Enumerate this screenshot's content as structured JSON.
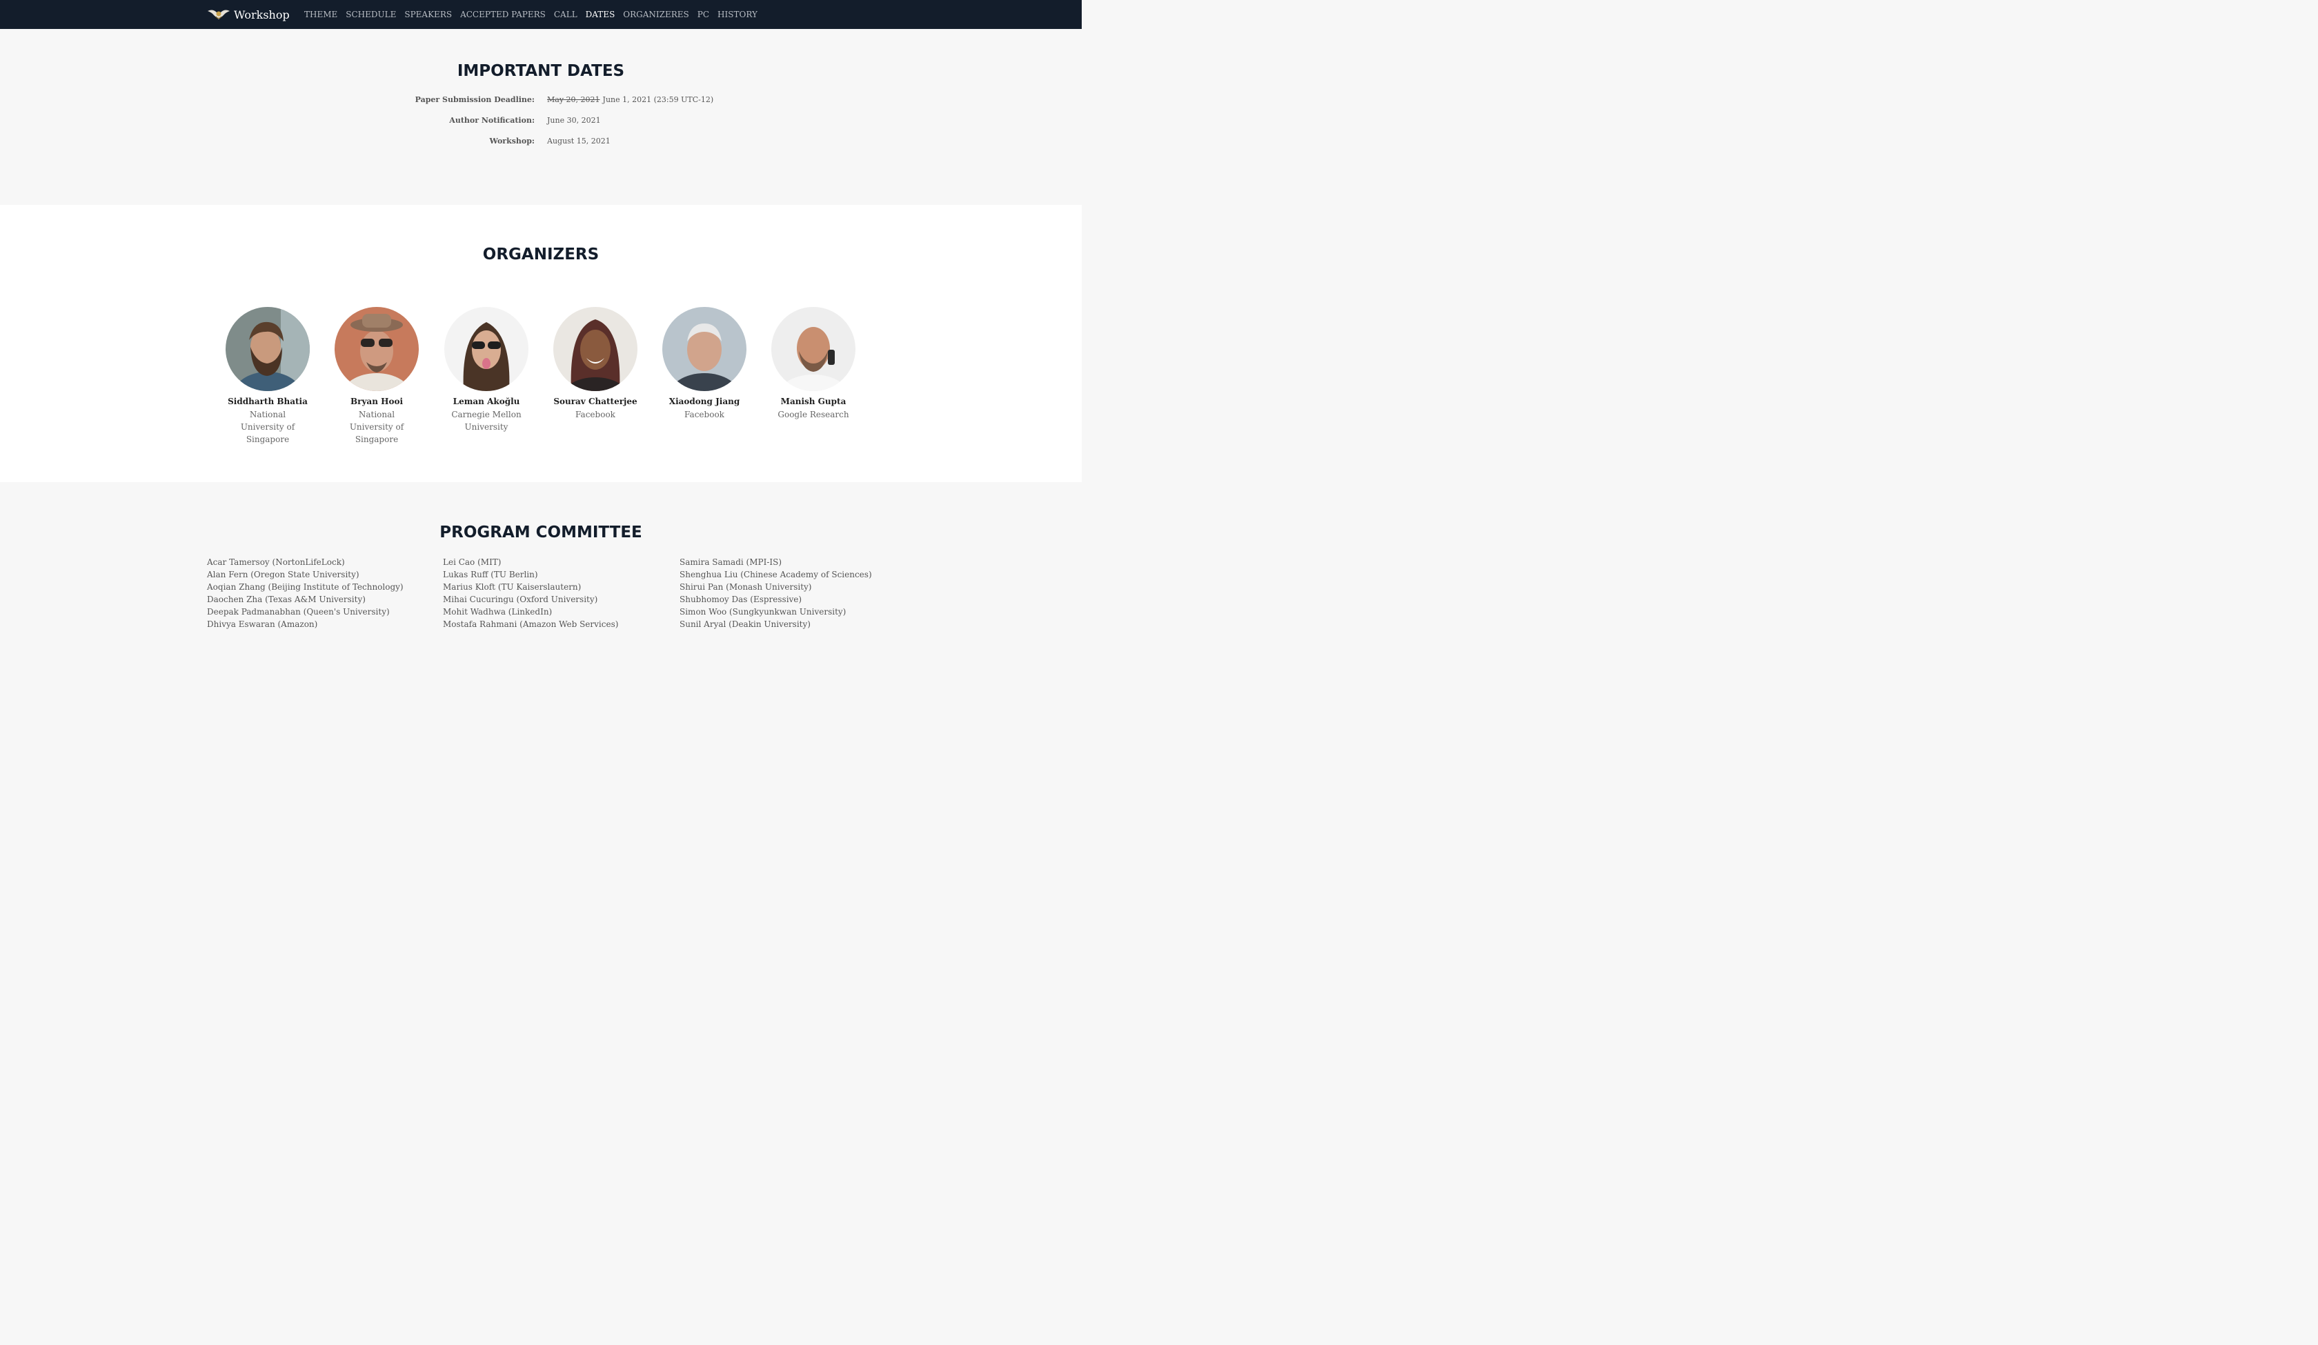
{
  "nav": {
    "brand": "Workshop",
    "links": [
      "THEME",
      "SCHEDULE",
      "SPEAKERS",
      "ACCEPTED PAPERS",
      "CALL",
      "DATES",
      "ORGANIZERES",
      "PC",
      "HISTORY"
    ],
    "active": "DATES"
  },
  "dates": {
    "title": "IMPORTANT DATES",
    "rows": [
      {
        "label": "Paper Submission Deadline:",
        "old_value": "May 20, 2021",
        "value": "June 1, 2021 (23:59 UTC-12)"
      },
      {
        "label": "Author Notification:",
        "value": "June 30, 2021"
      },
      {
        "label": "Workshop:",
        "value": "August 15, 2021"
      }
    ]
  },
  "organizers": {
    "title": "ORGANIZERS",
    "people": [
      {
        "name": "Siddharth Bhatia",
        "affiliation": "National University of Singapore"
      },
      {
        "name": "Bryan Hooi",
        "affiliation": "National University of Singapore"
      },
      {
        "name": "Leman Akoğlu",
        "affiliation": "Carnegie Mellon University"
      },
      {
        "name": "Sourav Chatterjee",
        "affiliation": "Facebook"
      },
      {
        "name": "Xiaodong Jiang",
        "affiliation": "Facebook"
      },
      {
        "name": "Manish Gupta",
        "affiliation": "Google Research"
      }
    ]
  },
  "pc": {
    "title": "PROGRAM COMMITTEE",
    "columns": [
      [
        "Acar Tamersoy (NortonLifeLock)",
        "Alan Fern (Oregon State University)",
        "Aoqian Zhang (Beijing Institute of Technology)",
        "Daochen Zha (Texas A&M University)",
        "Deepak Padmanabhan (Queen's University)",
        "Dhivya Eswaran (Amazon)"
      ],
      [
        "Lei Cao (MIT)",
        "Lukas Ruff (TU Berlin)",
        "Marius Kloft (TU Kaiserslautern)",
        "Mihai Cucuringu (Oxford University)",
        "Mohit Wadhwa (LinkedIn)",
        "Mostafa Rahmani (Amazon Web Services)"
      ],
      [
        "Samira Samadi (MPI-IS)",
        "Shenghua Liu (Chinese Academy of Sciences)",
        "Shirui Pan (Monash University)",
        "Shubhomoy Das (Espressive)",
        "Simon Woo (Sungkyunkwan University)",
        "Sunil Aryal (Deakin University)"
      ]
    ]
  }
}
